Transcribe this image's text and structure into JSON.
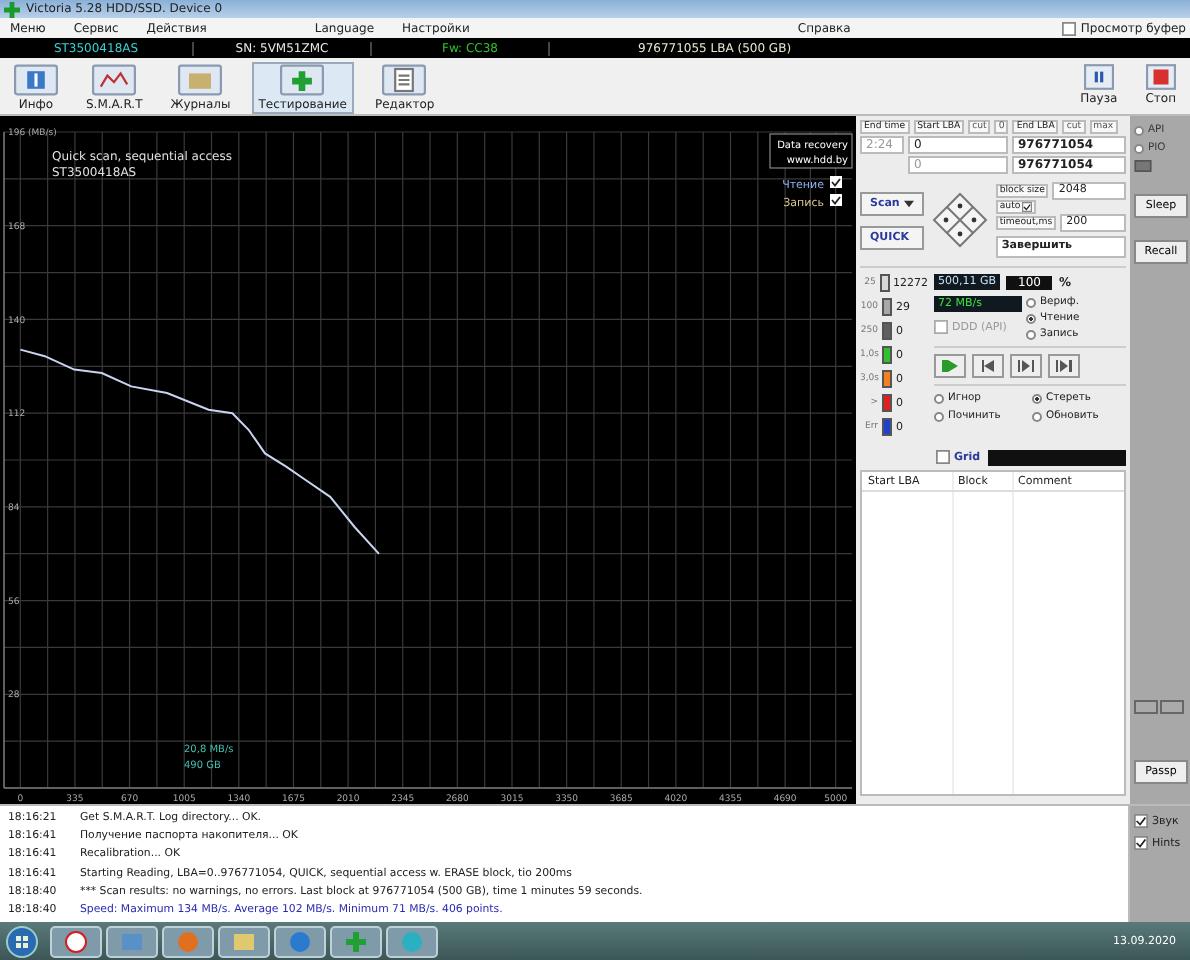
{
  "window": {
    "title": "Victoria 5.28 HDD/SSD. Device 0"
  },
  "menu": [
    {
      "label": "Меню"
    },
    {
      "label": "Сервис"
    },
    {
      "label": "Действия"
    },
    {
      "label": "Language"
    },
    {
      "label": "Настройки"
    },
    {
      "label": "Справка"
    }
  ],
  "buffer_view": {
    "label": "Просмотр буфер",
    "checked": false
  },
  "drive_bar": {
    "model": "ST3500418AS",
    "serial": "SN: 5VM51ZMC",
    "firmware": "Fw: CC38",
    "capacity": "976771055 LBA (500 GB)"
  },
  "toolbar": [
    {
      "label": "Инфо",
      "selected": false
    },
    {
      "label": "S.M.A.R.T",
      "selected": false
    },
    {
      "label": "Журналы",
      "selected": false
    },
    {
      "label": "Тестирование",
      "selected": true
    },
    {
      "label": "Редактор",
      "selected": false
    }
  ],
  "run_controls": [
    {
      "label": "Пауза",
      "kind": "pause"
    },
    {
      "label": "Стоп",
      "kind": "stop"
    }
  ],
  "chart": {
    "title": "Quick scan, sequential access",
    "model": "ST3500418AS",
    "promo": [
      "Data recovery",
      "www.hdd.by"
    ],
    "legend": [
      {
        "kind": "series",
        "checked": true,
        "color": "#8fb0f0"
      },
      {
        "kind": "label",
        "label": "Запись",
        "checked": true,
        "color": "#d8c890"
      }
    ],
    "readout": [
      "20,8 MB/s",
      "490 GB"
    ],
    "chart_data": {
      "type": "line",
      "x": [
        0,
        150,
        330,
        500,
        680,
        900,
        1155,
        1300,
        1400,
        1500,
        1630,
        1750,
        1900,
        2050,
        2200
      ],
      "series": [
        {
          "name": "Чтение",
          "color": "#c8d4f0",
          "values": [
            131,
            129,
            125,
            124,
            120,
            118,
            113,
            112,
            107,
            100,
            96,
            92,
            87,
            78,
            70
          ]
        }
      ],
      "xlim": [
        -100,
        5100
      ],
      "ylim": [
        0,
        196
      ],
      "grid": true,
      "xticks": [
        0,
        335,
        670,
        1005,
        1340,
        1675,
        2010,
        2345,
        2680,
        3015,
        3350,
        3685,
        4020,
        4355,
        4690,
        5000
      ],
      "yticks": [
        28,
        56,
        84,
        112,
        140,
        168,
        {
          "value": 196,
          "label": "196 (MB/s)"
        }
      ]
    }
  },
  "scan": {
    "end_time_label": "End time",
    "end_time": "2:24",
    "start_lba_label": "Start LBA",
    "start_cut": "cut",
    "start_zero": "0",
    "end_lba_label": "End LBA",
    "end_cut": "cut",
    "end_max": "max",
    "start_lba": "0",
    "end_lba": "976771054",
    "start_lba_2": "0",
    "end_lba_2": "976771054",
    "block_size_label": "block size",
    "auto_label": "auto",
    "auto_checked": true,
    "block_size": "2048",
    "timeout_label": "timeout,ms",
    "timeout": "200",
    "scan_button": "Scan",
    "quick_button": "QUICK",
    "action": "Завершить"
  },
  "counters": [
    {
      "label": "25",
      "count": "12272",
      "color": "#d8d8d8"
    },
    {
      "label": "100",
      "count": "29",
      "color": "#a8a8a8"
    },
    {
      "label": "250",
      "count": "0",
      "color": "#606060"
    },
    {
      "label": "1,0s",
      "count": "0",
      "color": "#30c030"
    },
    {
      "label": "3,0s",
      "count": "0",
      "color": "#f08020"
    },
    {
      "label": ">",
      "count": "0",
      "color": "#e02020"
    },
    {
      "label": "Err",
      "count": "0",
      "color": "#2040d0"
    }
  ],
  "stats": {
    "size": "500,11 GB",
    "percent": "100",
    "percent_sign": "%",
    "speed": "72 MB/s"
  },
  "ddd": {
    "label": "DDD (API)",
    "checked": false
  },
  "modes": [
    {
      "label": "Вериф.",
      "selected": false
    },
    {
      "label": "Чтение",
      "selected": true
    },
    {
      "label": "Запись",
      "selected": false
    }
  ],
  "repair": [
    {
      "label": "Игнор",
      "selected": false
    },
    {
      "label": "Стереть",
      "selected": true
    },
    {
      "label": "Починить",
      "selected": false
    },
    {
      "label": "Обновить",
      "selected": false
    }
  ],
  "grid": {
    "label": "Grid",
    "checked": false
  },
  "table": {
    "columns": [
      "Start LBA",
      "Block",
      "Comment"
    ]
  },
  "side": {
    "ports": [
      {
        "label": "API",
        "selected": false
      },
      {
        "label": "PIO",
        "selected": false
      }
    ],
    "buttons": [
      "Sleep",
      "Recall"
    ],
    "passport": "Passp"
  },
  "log": [
    {
      "time": "18:16:21",
      "text": "Get S.M.A.R.T. Log directory... OK.",
      "kind": "info"
    },
    {
      "time": "18:16:41",
      "text": "Получение паспорта накопителя... OK",
      "kind": "info"
    },
    {
      "time": "18:16:41",
      "text": "Recalibration... OK",
      "kind": "info"
    },
    {
      "time": "18:16:41",
      "text": "Starting Reading, LBA=0..976771054, QUICK, sequential access w. ERASE block, tio 200ms",
      "kind": "info"
    },
    {
      "time": "18:18:40",
      "text": "*** Scan results: no warnings, no errors. Last block at 976771054 (500 GB), time 1 minutes 59 seconds.",
      "kind": "info"
    },
    {
      "time": "18:18:40",
      "text": "Speed: Maximum 134 MB/s. Average 102 MB/s. Minimum 71 MB/s. 406 points.",
      "kind": "result"
    }
  ],
  "options": [
    {
      "label": "Звук",
      "checked": true
    },
    {
      "label": "Hints",
      "checked": true
    }
  ],
  "taskbar": {
    "date": "13.09.2020"
  }
}
